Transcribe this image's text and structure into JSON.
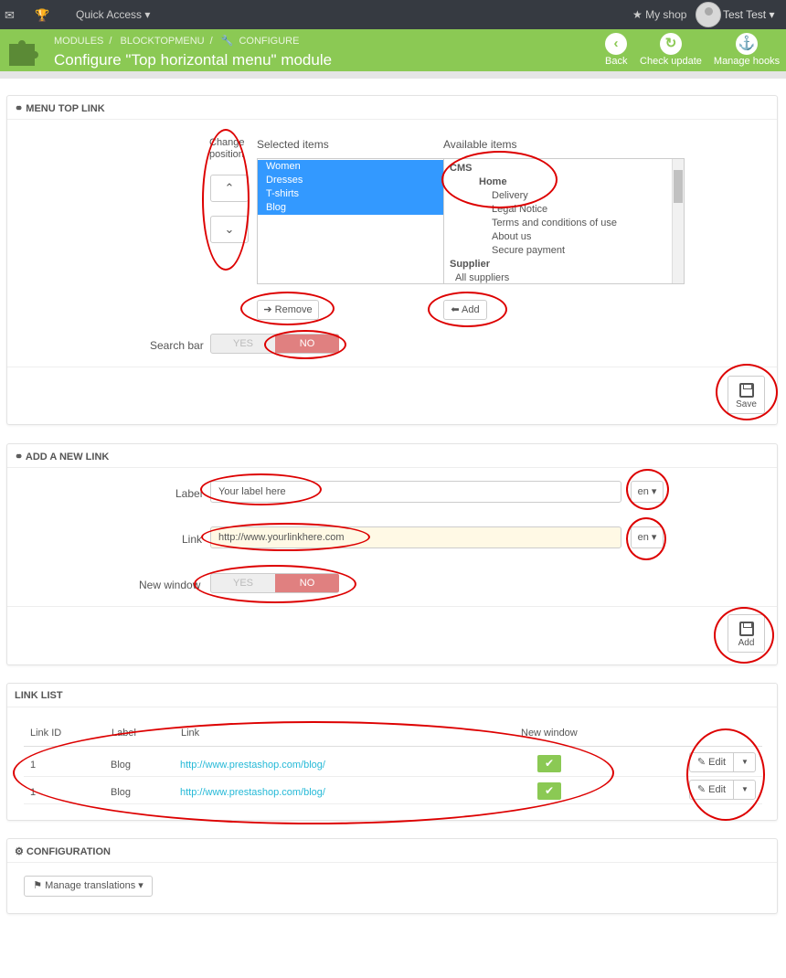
{
  "topbar": {
    "mail_icon": "envelope-icon",
    "trophy_icon": "trophy-icon",
    "quick_access": "Quick Access",
    "my_shop": "My shop",
    "user": "Test Test"
  },
  "header": {
    "crumbs": [
      "MODULES",
      "BLOCKTOPMENU",
      "CONFIGURE"
    ],
    "title": "Configure \"Top horizontal menu\" module",
    "buttons": {
      "back": "Back",
      "check": "Check update",
      "hooks": "Manage hooks"
    }
  },
  "menu_top": {
    "title": "MENU TOP LINK",
    "change_position": "Change position",
    "selected_label": "Selected items",
    "available_label": "Available items",
    "selected": [
      "Women",
      "Dresses",
      "T-shirts",
      "Blog"
    ],
    "available": [
      {
        "t": "CMS",
        "b": true,
        "i": 0
      },
      {
        "t": "Home",
        "b": true,
        "i": 1
      },
      {
        "t": "Delivery",
        "b": false,
        "i": 2
      },
      {
        "t": "Legal Notice",
        "b": false,
        "i": 2
      },
      {
        "t": "Terms and conditions of use",
        "b": false,
        "i": 2
      },
      {
        "t": "About us",
        "b": false,
        "i": 2
      },
      {
        "t": "Secure payment",
        "b": false,
        "i": 2
      },
      {
        "t": "Supplier",
        "b": true,
        "i": 0
      },
      {
        "t": "All suppliers",
        "b": false,
        "i": 0
      }
    ],
    "remove": "Remove",
    "add": "Add",
    "search_bar": "Search bar",
    "yes": "YES",
    "no": "NO",
    "save": "Save"
  },
  "new_link": {
    "title": "ADD A NEW LINK",
    "label": "Label",
    "label_value": "Your label here",
    "link": "Link",
    "link_value": "http://www.yourlinkhere.com",
    "lang": "en",
    "new_window": "New window",
    "yes": "YES",
    "no": "NO",
    "add": "Add"
  },
  "link_list": {
    "title": "LINK LIST",
    "headers": [
      "Link ID",
      "Label",
      "Link",
      "New window"
    ],
    "rows": [
      {
        "id": "1",
        "label": "Blog",
        "link": "http://www.prestashop.com/blog/"
      },
      {
        "id": "1",
        "label": "Blog",
        "link": "http://www.prestashop.com/blog/"
      }
    ],
    "edit": "Edit"
  },
  "configuration": {
    "title": "CONFIGURATION",
    "manage": "Manage translations"
  },
  "colors": {
    "green": "#8bc954",
    "dark": "#363a41",
    "link": "#25b9d7",
    "no": "#e08080",
    "annotation": "#dd0000"
  }
}
